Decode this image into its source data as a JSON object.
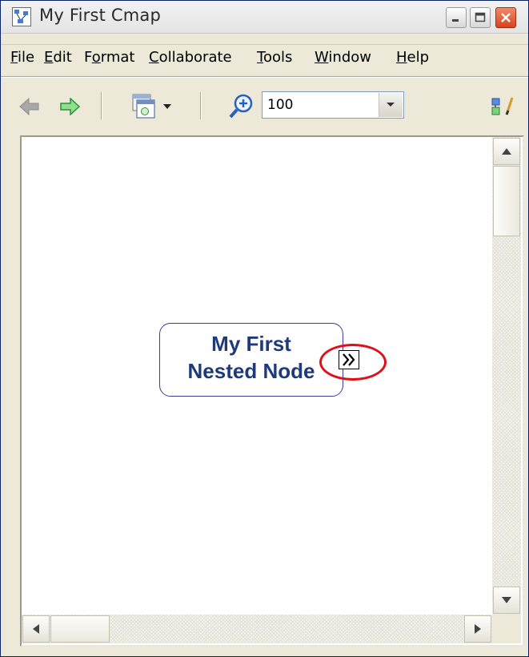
{
  "window": {
    "title": "My First Cmap"
  },
  "menu": {
    "items": [
      {
        "label": "File",
        "underline": "F",
        "rest": "ile"
      },
      {
        "label": "Edit",
        "underline": "E",
        "rest": "dit"
      },
      {
        "label": "Format",
        "pre": "F",
        "underline": "o",
        "rest": "rmat"
      },
      {
        "label": "Collaborate",
        "underline": "C",
        "rest": "ollaborate"
      },
      {
        "label": "Tools",
        "underline": "T",
        "rest": "ools"
      },
      {
        "label": "Window",
        "underline": "W",
        "rest": "indow"
      },
      {
        "label": "Help",
        "underline": "H",
        "rest": "elp"
      }
    ]
  },
  "toolbar": {
    "zoom_value": "100",
    "icons": [
      "back-arrow-icon",
      "forward-arrow-icon",
      "nested-node-dropdown-icon",
      "zoom-icon",
      "style-palette-icon"
    ]
  },
  "node": {
    "line1": "My First",
    "line2": "Nested Node"
  },
  "colors": {
    "node_border": "#3c3c9c",
    "node_text": "#1f3a7a",
    "highlight": "#e0101a"
  }
}
